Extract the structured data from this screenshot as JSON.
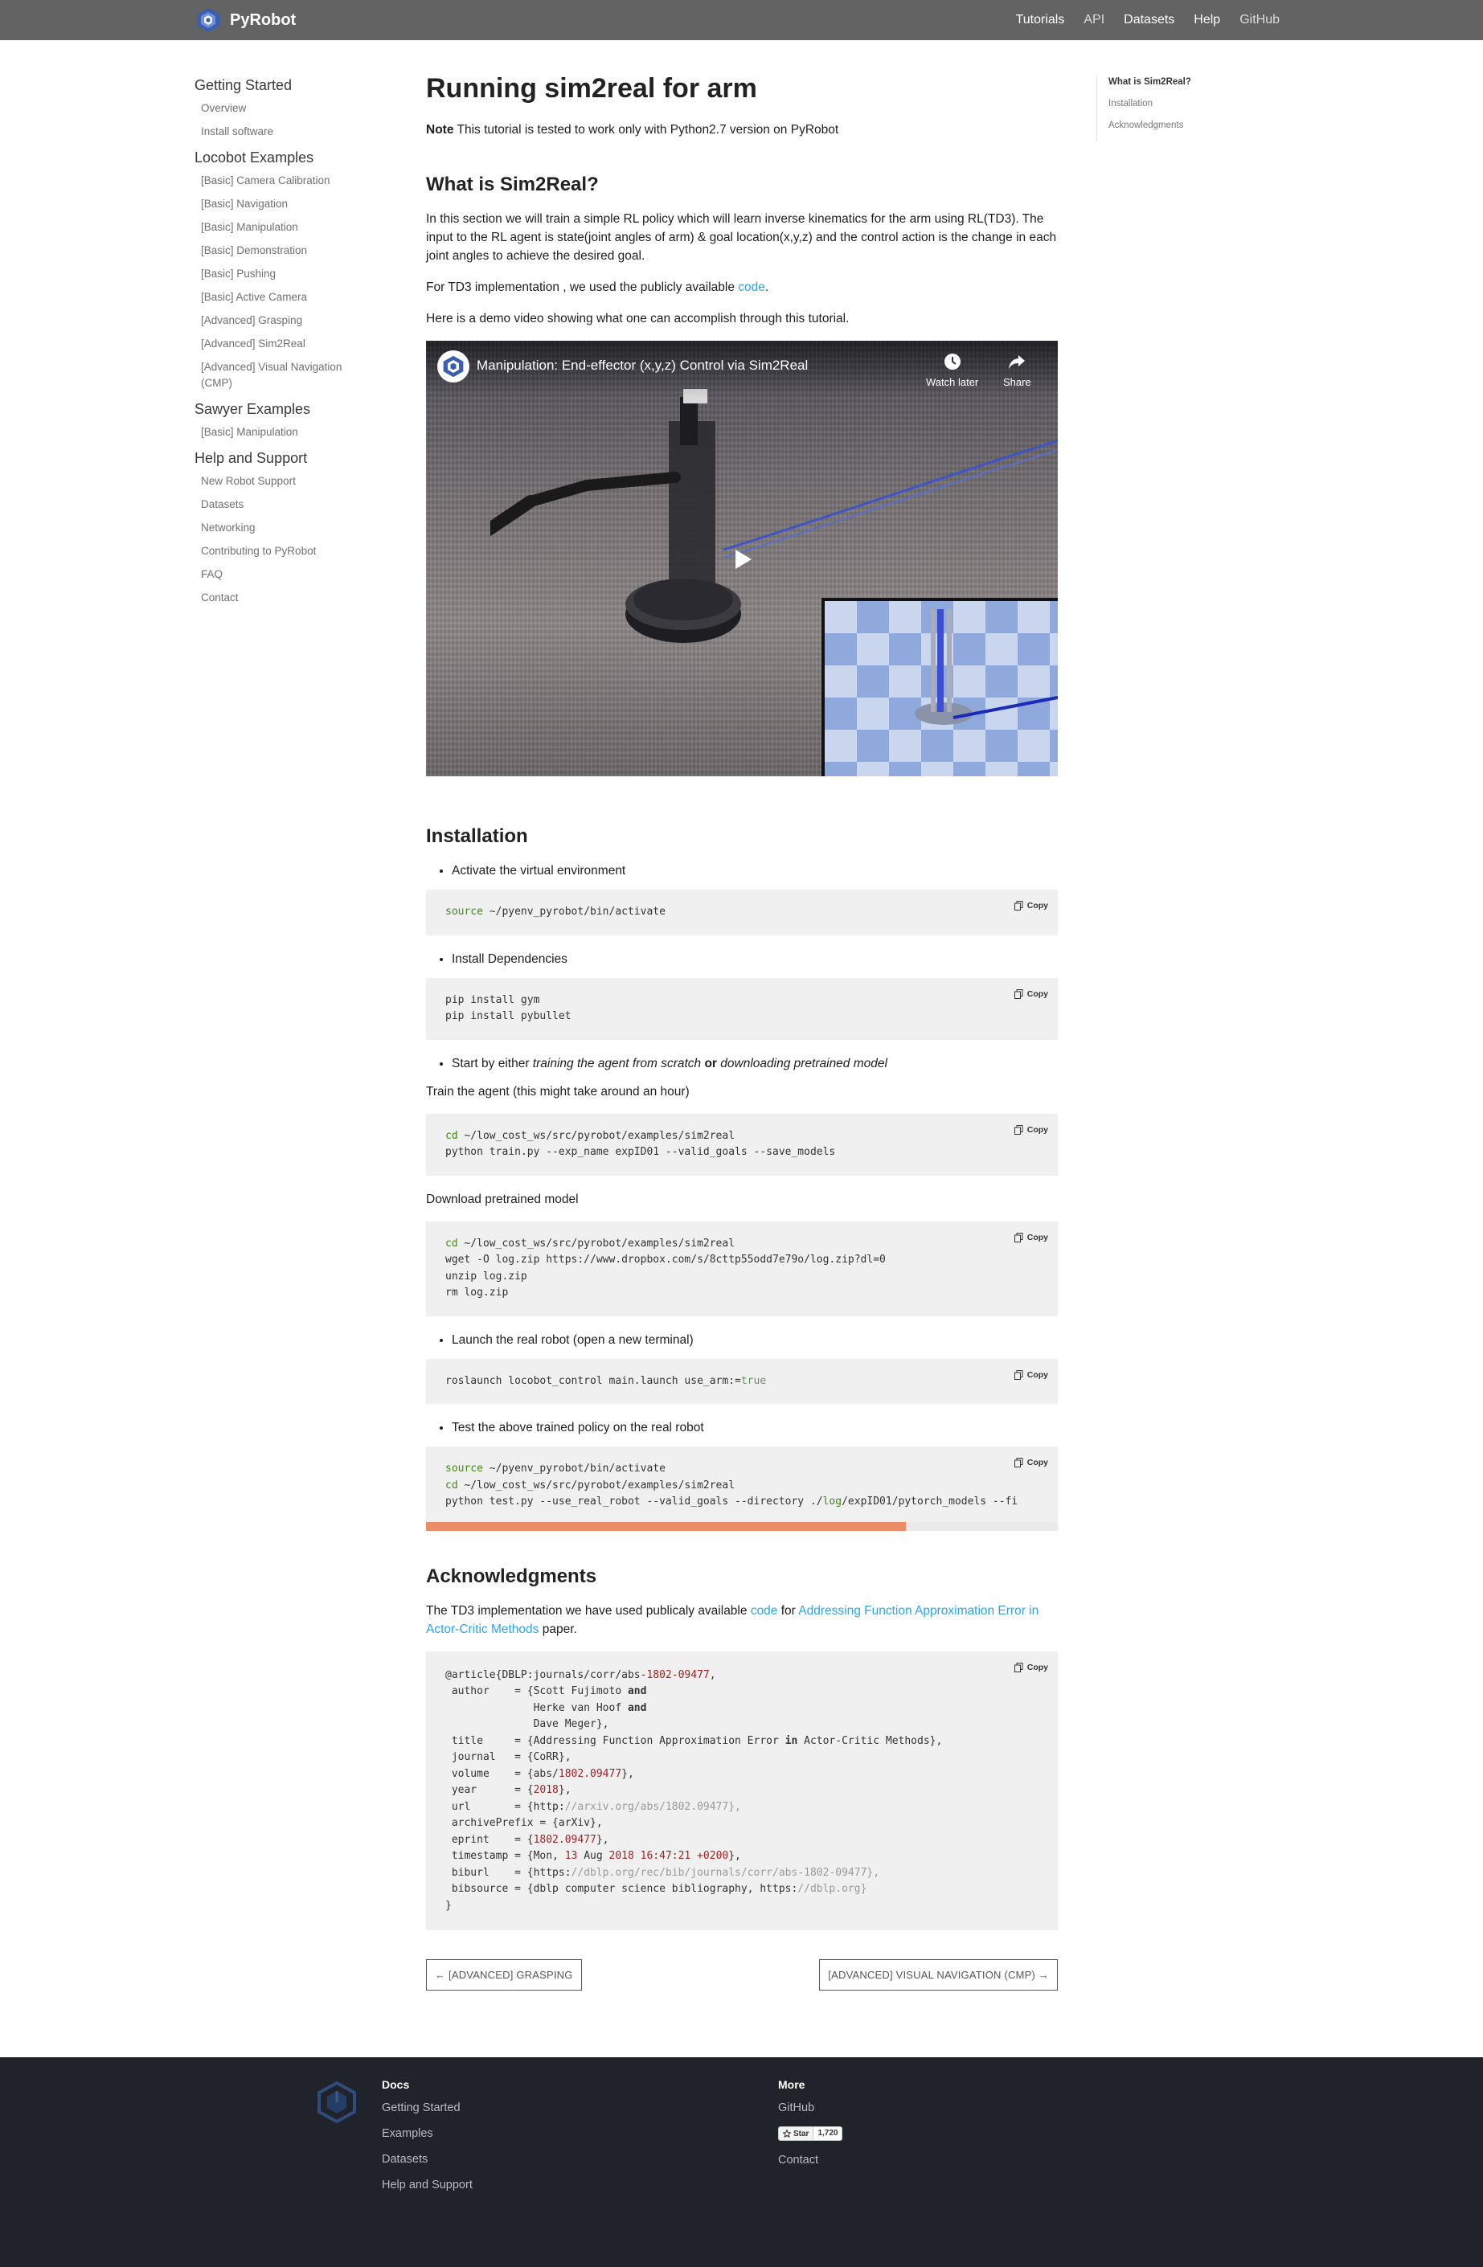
{
  "nav": {
    "brand": "PyRobot",
    "links": [
      "Tutorials",
      "API",
      "Datasets",
      "Help",
      "GitHub"
    ]
  },
  "sidebar": {
    "groups": [
      {
        "title": "Getting Started",
        "items": [
          "Overview",
          "Install software"
        ]
      },
      {
        "title": "Locobot Examples",
        "items": [
          "[Basic] Camera Calibration",
          "[Basic] Navigation",
          "[Basic] Manipulation",
          "[Basic] Demonstration",
          "[Basic] Pushing",
          "[Basic] Active Camera",
          "[Advanced] Grasping",
          "[Advanced] Sim2Real",
          "[Advanced] Visual Navigation (CMP)"
        ]
      },
      {
        "title": "Sawyer Examples",
        "items": [
          "[Basic] Manipulation"
        ]
      },
      {
        "title": "Help and Support",
        "items": [
          "New Robot Support",
          "Datasets",
          "Networking",
          "Contributing to PyRobot",
          "FAQ",
          "Contact"
        ]
      }
    ]
  },
  "toc": {
    "items": [
      "What is Sim2Real?",
      "Installation",
      "Acknowledgments"
    ]
  },
  "main": {
    "title": "Running sim2real for arm",
    "note_label": "Note",
    "note_text": " This tutorial is tested to work only with Python2.7 version on PyRobot",
    "sec1_title": "What is Sim2Real?",
    "sec1_p1": "In this section we will train a simple RL policy which will learn inverse kinematics for the arm using RL(TD3). The input to the RL agent is state(joint angles of arm) & goal location(x,y,z) and the control action is the change in each joint angles to achieve the desired goal.",
    "sec1_p2_pre": "For TD3 implementation , we used the publicly available ",
    "sec1_p2_link": "code",
    "sec1_p2_post": ".",
    "sec1_p3": "Here is a demo video showing what one can accomplish through this tutorial.",
    "video": {
      "title": "Manipulation: End-effector (x,y,z) Control via Sim2Real",
      "watch_later": "Watch later",
      "share": "Share"
    },
    "sec2_title": "Installation",
    "copy_label": "Copy",
    "step1": "Activate the virtual environment",
    "code1": {
      "kw": "source",
      "rest": " ~/pyenv_pyrobot/bin/activate"
    },
    "step2": "Install Dependencies",
    "code2": {
      "line1": "pip install gym",
      "line2": "pip install pybullet"
    },
    "step3_pre": "Start by either ",
    "step3_em1": "training the agent from scratch",
    "step3_or": " or ",
    "step3_em2": "downloading pretrained model",
    "train_text": "Train the agent (this might take around an hour)",
    "code3": {
      "kw": "cd",
      "l1": " ~/low_cost_ws/src/pyrobot/examples/sim2real",
      "l2": "python train.py --exp_name expID01 --valid_goals --save_models"
    },
    "download_text": "Download pretrained model",
    "code4": {
      "kw": "cd",
      "l1": " ~/low_cost_ws/src/pyrobot/examples/sim2real",
      "l2": "wget -O log.zip https://www.dropbox.com/s/8cttp55odd7e79o/log.zip?dl=0",
      "l3": "unzip log.zip",
      "l4": "rm log.zip"
    },
    "step4": "Launch the real robot (open a new terminal)",
    "code5": {
      "pre": "roslaunch locobot_control main.launch use_arm:=",
      "val": "true"
    },
    "step5": "Test the above trained policy on the real robot",
    "code6": {
      "kw1": "source",
      "l1": " ~/pyenv_pyrobot/bin/activate",
      "kw2": "cd",
      "l2": " ~/low_cost_ws/src/pyrobot/examples/sim2real",
      "l3a": "python test.py --use_real_robot --valid_goals --directory ./",
      "l3b": "log",
      "l3c": "/expID01/pytorch_models --fi"
    },
    "sec3_title": "Acknowledgments",
    "ack_pre": "The TD3 implementation we have used publicaly available ",
    "ack_link1": "code",
    "ack_mid": " for ",
    "ack_link2": "Addressing Function Approximation Error in Actor-Critic Methods",
    "ack_post": " paper.",
    "pager_prev": "← [ADVANCED] GRASPING",
    "pager_next": "[ADVANCED] VISUAL NAVIGATION (CMP) →"
  },
  "bibtex": {
    "l1a": "@article{DBLP:journals/corr/abs-",
    "l1b": "1802-09477",
    "l1c": ",",
    "l2a": " author    = {Scott Fujimoto ",
    "l2b": "and",
    "l3a": "              Herke van Hoof ",
    "l3b": "and",
    "l4": "              Dave Meger},",
    "l5a": " title     = {Addressing Function Approximation Error ",
    "l5b": "in",
    "l5c": " Actor-Critic Methods},",
    "l6": " journal   = {CoRR},",
    "l7a": " volume    = {abs/",
    "l7b": "1802.09477",
    "l7c": "},",
    "l8a": " year      = {",
    "l8b": "2018",
    "l8c": "},",
    "l9a": " url       = {http:",
    "l9b": "//arxiv.org/abs/1802.09477},",
    "l10": " archivePrefix = {arXiv},",
    "l11a": " eprint    = {",
    "l11b": "1802.09477",
    "l11c": "},",
    "l12a": " timestamp = {Mon, ",
    "l12b": "13",
    "l12c": " Aug ",
    "l12d": "2018 16:47:21 +0200",
    "l12e": "},",
    "l13a": " biburl    = {https:",
    "l13b": "//dblp.org/rec/bib/journals/corr/abs-1802-09477},",
    "l14a": " bibsource = {dblp computer science bibliography, https:",
    "l14b": "//dblp.org}",
    "l15": "}"
  },
  "footer": {
    "docs_title": "Docs",
    "docs_links": [
      "Getting Started",
      "Examples",
      "Datasets",
      "Help and Support"
    ],
    "more_title": "More",
    "github": "GitHub",
    "star_label": "Star",
    "star_count": "1,720",
    "contact": "Contact"
  },
  "colors": {
    "nav_bg": "#636363",
    "link": "#2aa6e8",
    "footer_bg": "#20232a",
    "scroll_thumb": "#e98e66",
    "code_bg": "#f0f0f0"
  },
  "icons": [
    "pyrobot-logo-icon",
    "clock-icon",
    "share-icon",
    "play-icon",
    "copy-icon",
    "github-icon"
  ]
}
